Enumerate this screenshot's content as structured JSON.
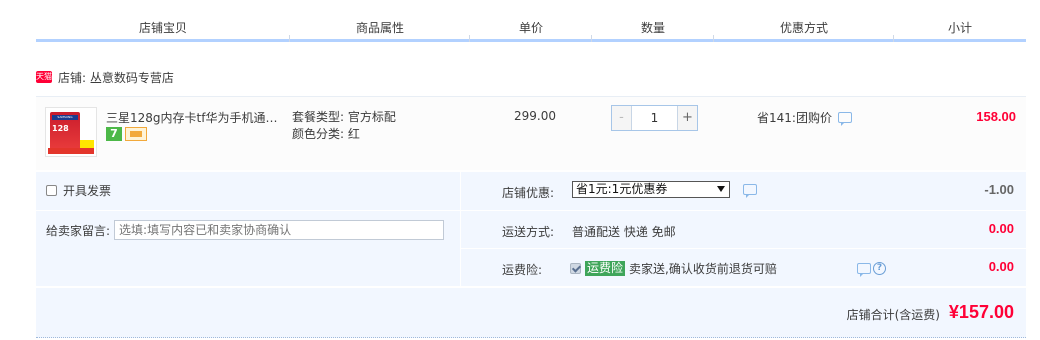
{
  "table_header": {
    "columns": [
      "店铺宝贝",
      "商品属性",
      "单价",
      "数量",
      "优惠方式",
      "小计"
    ]
  },
  "shop": {
    "badge": "天猫",
    "label": "店铺: 丛意数码专营店"
  },
  "item": {
    "thumb": {
      "brand": "SAMSUNG",
      "capacity": "128"
    },
    "title": "三星128g内存卡tf华为手机通用...",
    "service_icons": [
      "seven-day-return-icon",
      "card-pay-icon"
    ],
    "seven_label": "7",
    "attrs": {
      "package": "套餐类型: 官方标配",
      "color": "颜色分类: 红"
    },
    "price": "299.00",
    "quantity": {
      "minus": "-",
      "value": "1",
      "plus": "+"
    },
    "promo": "省141:团购价",
    "subtotal": "158.00"
  },
  "order": {
    "invoice_label": "开具发票",
    "memo_label": "给卖家留言:",
    "memo_placeholder": "选填:填写内容已和卖家协商确认",
    "shop_discount_label": "店铺优惠:",
    "shop_discount_selected": "省1元:1元优惠券",
    "shop_discount_amount": "-1.00",
    "shipping_label": "运送方式:",
    "shipping_value": "普通配送 快递 免邮",
    "shipping_amount": "0.00",
    "insurance_label": "运费险:",
    "insurance_badge": "运费险",
    "insurance_text": "卖家送,确认收货前退货可赔",
    "insurance_amount": "0.00",
    "help_glyph": "?"
  },
  "total": {
    "label": "店铺合计(含运费)",
    "amount": "¥157.00"
  },
  "colors": {
    "accent_red": "#ff0036",
    "header_border": "#b2d1ff",
    "block_bg": "#f2f7ff",
    "insurance_green": "#3fa55a"
  }
}
